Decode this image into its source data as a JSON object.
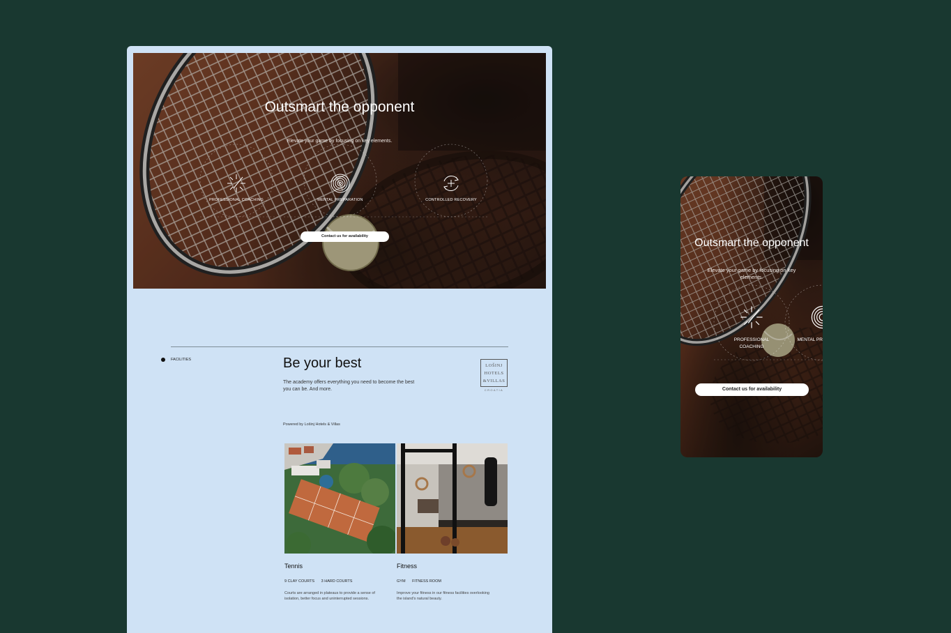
{
  "desktop": {
    "hero": {
      "title": "Outsmart the opponent",
      "subtitle": "Elevate your game by focusing on key elements.",
      "features": [
        {
          "label": "PROFESSIONAL COACHING",
          "icon": "spark-icon"
        },
        {
          "label": "MENTAL PREPARATION",
          "icon": "target-icon"
        },
        {
          "label": "CONTROLLED RECOVERY",
          "icon": "recovery-cycle-icon"
        }
      ],
      "cta": "Contact us for availability"
    },
    "facilities": {
      "section_label": "FACILITIES",
      "title": "Be your best",
      "description": "The academy offers everything you need to become the best you can be. And more.",
      "logo": {
        "lines": [
          "LOŠINJ",
          "HOTELS",
          "&VILLAS"
        ],
        "country": "CROATIA"
      },
      "powered_by": "Powered by Lošinj Hotels & Villas",
      "cards": [
        {
          "name": "Tennis",
          "tags": [
            "9 CLAY COURTS",
            "3 HARD COURTS"
          ],
          "description": "Courts are arranged in plateaus to provide a sense of isolation, better focus and uninterrupted sessions."
        },
        {
          "name": "Fitness",
          "tags": [
            "GYM",
            "FITNESS ROOM"
          ],
          "description": "Improve your fitness in our fitness facilities overlooking the island's natural beauty."
        }
      ]
    }
  },
  "mobile": {
    "title": "Outsmart the opponent",
    "subtitle": "Elevate your game by focusing on key elements.",
    "features": [
      {
        "label": "PROFESSIONAL COACHING",
        "icon": "spark-icon"
      },
      {
        "label": "MENTAL PREPARATION",
        "icon": "target-icon"
      }
    ],
    "cta": "Contact us for availability"
  },
  "colors": {
    "background": "#193830",
    "desktop_page": "#cfe2f5",
    "clay": "#7a4229",
    "button": "#ffffff"
  }
}
